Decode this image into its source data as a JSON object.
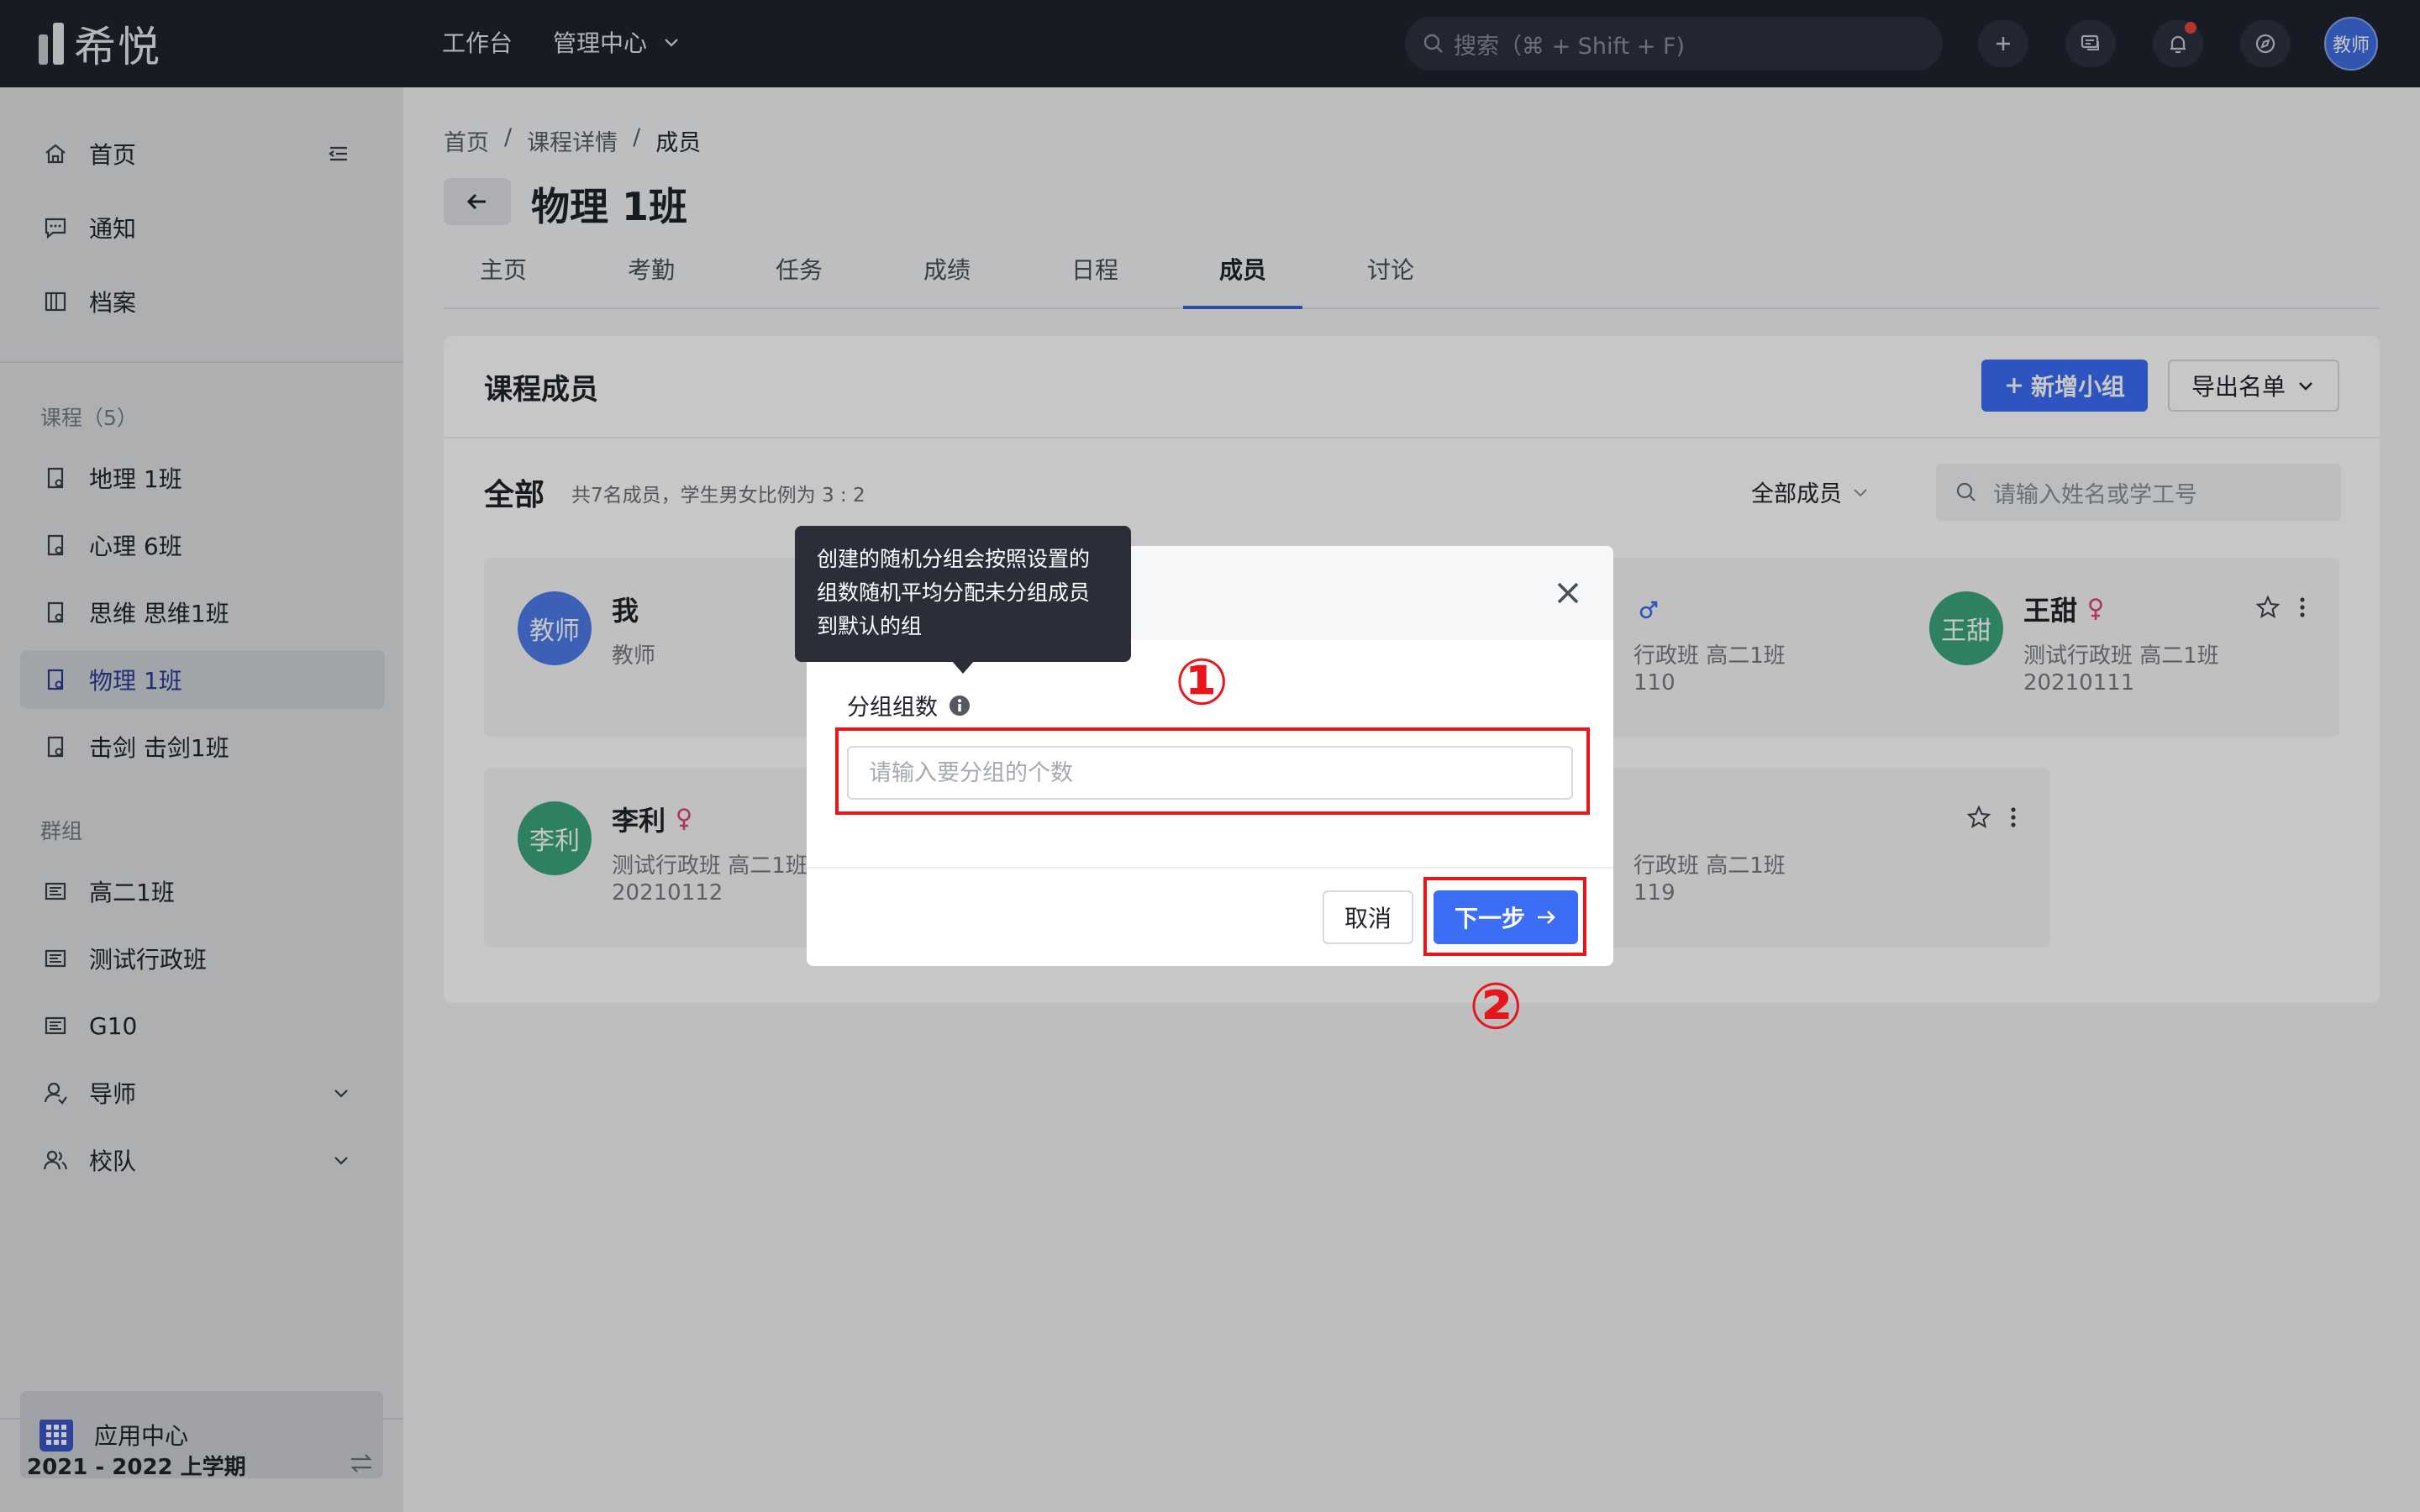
{
  "topbar": {
    "logo_text": "希悦",
    "nav_workbench": "工作台",
    "nav_admin": "管理中心",
    "search_placeholder": "搜索（⌘ + Shift + F)",
    "avatar": "教师"
  },
  "sidebar": {
    "home": "首页",
    "notice": "通知",
    "archive": "档案",
    "courses_label": "课程（5）",
    "courses": [
      "地理 1班",
      "心理 6班",
      "思维 思维1班",
      "物理 1班",
      "击剑 击剑1班"
    ],
    "groups_label": "群组",
    "groups": [
      "高二1班",
      "测试行政班",
      "G10"
    ],
    "mentor": "导师",
    "team": "校队",
    "app_center": "应用中心",
    "term": "2021 - 2022 上学期"
  },
  "page": {
    "breadcrumb": [
      "首页",
      "/",
      "课程详情",
      "/",
      "成员"
    ],
    "title": "物理 1班",
    "tabs": [
      "主页",
      "考勤",
      "任务",
      "成绩",
      "日程",
      "成员",
      "讨论"
    ],
    "active_tab": "成员"
  },
  "members": {
    "card_title": "课程成员",
    "add_group": "新增小组",
    "export": "导出名单",
    "all": "全部",
    "summary": "共7名成员，学生男女比例为 3 : 2",
    "filter": "全部成员",
    "search_placeholder": "请输入姓名或学工号",
    "cards": [
      {
        "avatar": "教师",
        "name": "我",
        "line1": "教师",
        "line2": "",
        "color": "#4e7ce8"
      },
      {
        "avatar": "",
        "name": "",
        "line1": "行政班 高二1班",
        "line2": "110",
        "color": ""
      },
      {
        "avatar": "王甜",
        "name": "王甜",
        "line1": "测试行政班 高二1班",
        "line2": "20210111",
        "color": "#3aa57c"
      },
      {
        "avatar": "李利",
        "name": "李利",
        "line1": "测试行政班 高二1班",
        "line2": "20210112",
        "color": "#3aa57c"
      },
      {
        "avatar": "",
        "name": "",
        "line1": "行政班 高二1班",
        "line2": "119",
        "color": ""
      }
    ]
  },
  "modal": {
    "field_label": "分组组数",
    "input_placeholder": "请输入要分组的个数",
    "cancel": "取消",
    "next": "下一步",
    "tooltip": "创建的随机分组会按照设置的组数随机平均分配未分组成员到默认的组"
  },
  "annotations": {
    "marker1": "①",
    "marker2": "②",
    "highlight_color": "#e8161b"
  },
  "colors": {
    "primary": "#3b6ef5",
    "topbar": "#1f232e",
    "female": "#e0457b",
    "male": "#3b6ef5"
  }
}
